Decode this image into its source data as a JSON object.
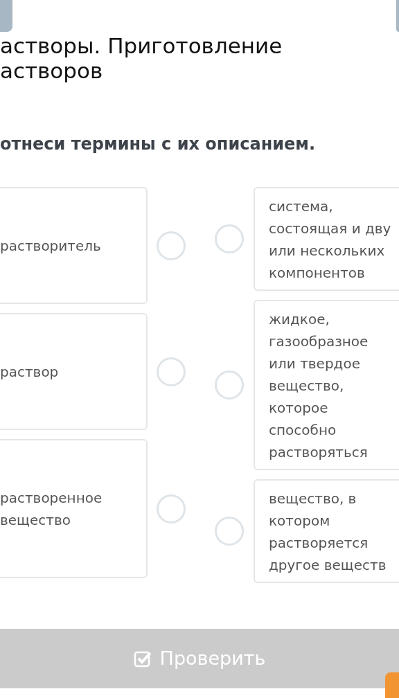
{
  "title": "астворы. Приготовление астворов",
  "instruction": "отнеси термины с их описанием.",
  "terms": [
    {
      "lines": [
        "растворитель"
      ]
    },
    {
      "lines": [
        "раствор"
      ]
    },
    {
      "lines": [
        "растворенное",
        "вещество"
      ]
    }
  ],
  "descriptions": [
    {
      "lines": [
        "система,",
        "состоящая и дву",
        "или нескольких",
        "компонентов"
      ]
    },
    {
      "lines": [
        "жидкое,",
        "газообразное",
        "или твердое",
        "вещество,",
        "которое",
        "способно",
        "растворяться"
      ]
    },
    {
      "lines": [
        "вещество, в",
        "котором",
        "растворяется",
        "другое веществ"
      ]
    }
  ],
  "check_button": {
    "label": "Проверить",
    "disabled": true
  }
}
